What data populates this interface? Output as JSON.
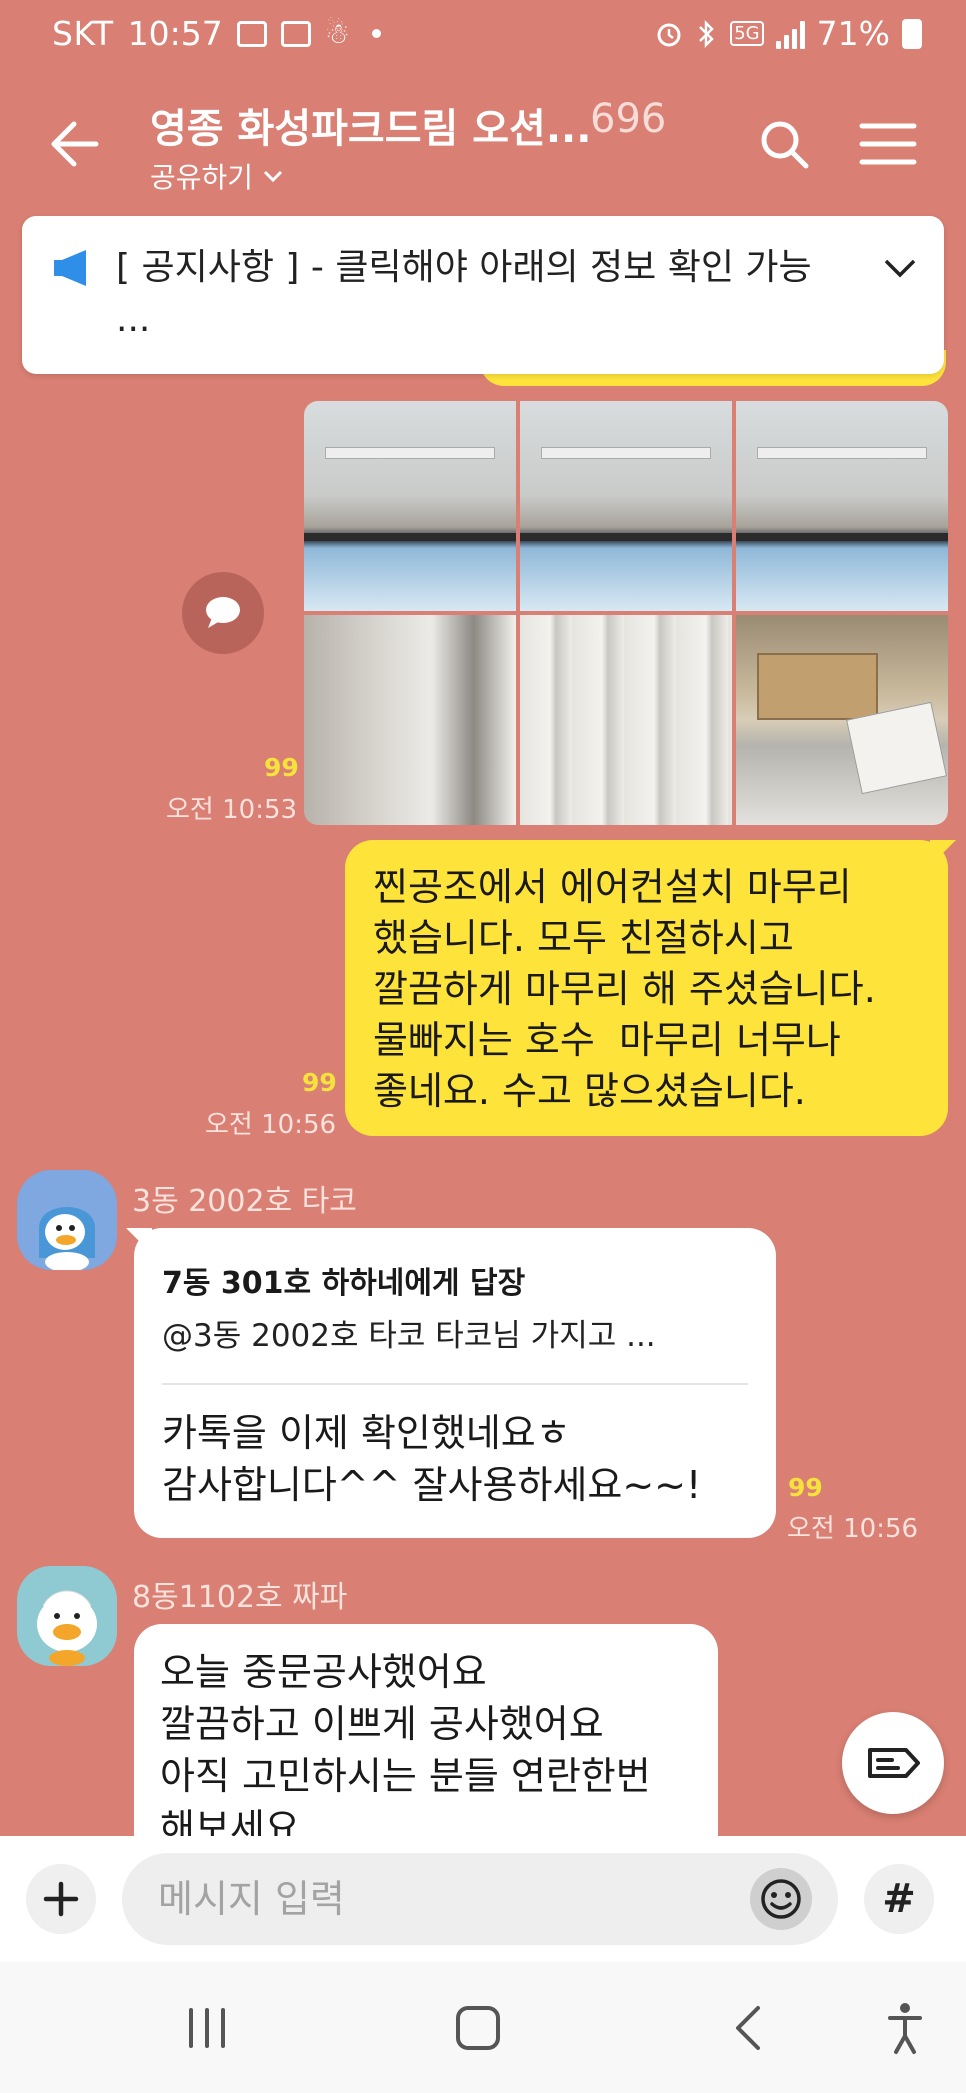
{
  "status": {
    "carrier": "SKT",
    "time": "10:57",
    "network": "5G",
    "battery": "71%"
  },
  "header": {
    "title": "영종 화성파크드림 오션...",
    "member_count": "696",
    "share_label": "공유하기"
  },
  "notice": {
    "text": "[ 공지사항 ] - 클릭해야 아래의 정보 확인 가능 ..."
  },
  "messages": {
    "photos": {
      "read_count": "99",
      "time": "오전 10:53"
    },
    "mine": {
      "text": "찐공조에서 에어컨설치 마무리\n했습니다. 모두 친절하시고\n깔끔하게 마무리 해 주셨습니다.\n물빠지는 호수  마무리 너무나\n좋네요. 수고 많으셨습니다.",
      "read_count": "99",
      "time": "오전 10:56"
    },
    "reply": {
      "sender": "3동 2002호 타코",
      "reply_to": "7동 301호 하하네에게 답장",
      "quote": "@3동 2002호 타코   타코님 가지고 ...",
      "text": "카톡을 이제 확인했네요ㅎ\n감사합니다^^ 잘사용하세요~~!",
      "read_count": "99",
      "time": "오전 10:56"
    },
    "last": {
      "sender": "8동1102호 짜파",
      "text": "오늘 중문공사했어요\n깔끔하고 이쁘게 공사했어요\n아직 고민하시는 분들 연란한번\n해보세요"
    },
    "top_read_count": "99"
  },
  "input": {
    "placeholder": "메시지 입력",
    "hash_label": "#"
  },
  "colors": {
    "chat_background": "#d97f73",
    "my_bubble": "#fee33b",
    "other_bubble": "#ffffff",
    "read_count": "#f5e23c"
  },
  "icons": [
    "back-arrow-icon",
    "search-icon",
    "menu-icon",
    "megaphone-icon",
    "chevron-down-icon",
    "speech-bubble-icon",
    "tag-icon",
    "plus-icon",
    "emoji-icon",
    "recents-icon",
    "home-icon",
    "back-icon",
    "accessibility-icon"
  ]
}
